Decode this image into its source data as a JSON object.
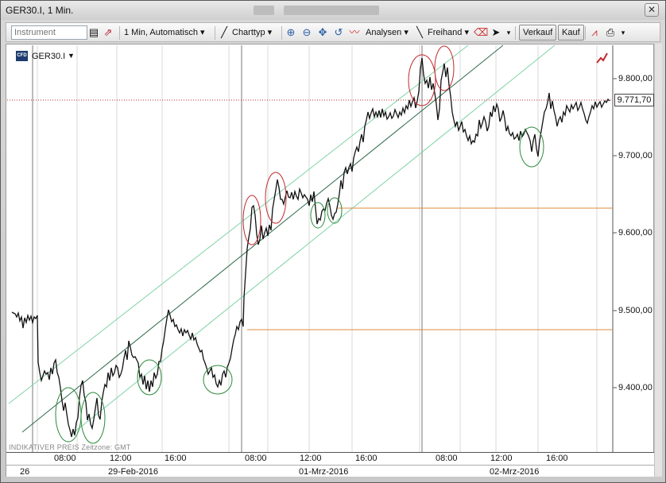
{
  "window": {
    "title": "GER30.I, 1 Min."
  },
  "toolbar": {
    "instrument_placeholder": "Instrument",
    "interval_label": "1 Min,  Automatisch",
    "charttyp_label": "Charttyp",
    "analysen_label": "Analysen",
    "freihand_label": "Freihand",
    "verkauf_label": "Verkauf",
    "kauf_label": "Kauf"
  },
  "chart": {
    "symbol": "GER30.I",
    "indicative_text": "INDIKATIVER PREIS   Zeitzone: GMT",
    "current_price": "9.771,70",
    "y_ticks": [
      "9.800,00",
      "9.700,00",
      "9.600,00",
      "9.500,00",
      "9.400,00"
    ],
    "x_time_labels": [
      "08:00",
      "12:00",
      "16:00",
      "08:00",
      "12:00",
      "16:00",
      "08:00",
      "12:00",
      "16:00"
    ],
    "x_date_labels": [
      "26",
      "29-Feb-2016",
      "01-Mrz-2016",
      "02-Mrz-2016"
    ]
  },
  "colors": {
    "price_line": "#111111",
    "channel_mid": "#2e6b4a",
    "channel_outer": "#7fd3a6",
    "horizontal_level": "#e08a3c",
    "circle_red": "#c0282d",
    "circle_green": "#2a8a3a",
    "current_price_line": "#c0282d"
  }
}
